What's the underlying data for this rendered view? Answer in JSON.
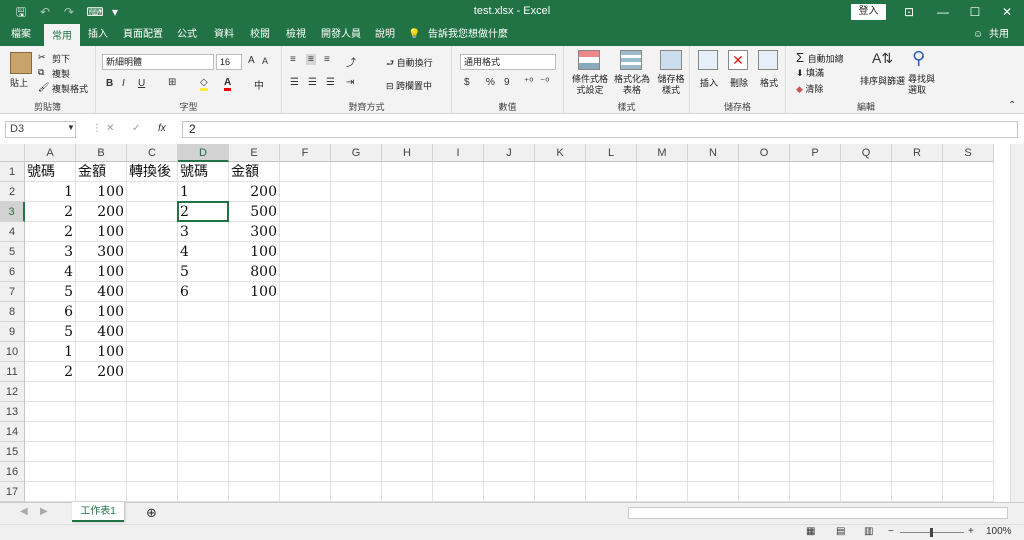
{
  "window": {
    "title": "test.xlsx  -  Excel",
    "login": "登入",
    "min": "—",
    "restore": "☐",
    "close": "✕",
    "ribbon_display": "⊡"
  },
  "quick_access": {
    "save": "🖫",
    "undo": "↶",
    "redo": "↷",
    "touch": "⌨",
    "customize": "▾"
  },
  "menu": {
    "items": [
      "檔案",
      "常用",
      "插入",
      "頁面配置",
      "公式",
      "資料",
      "校閱",
      "檢視",
      "開發人員",
      "說明"
    ],
    "active": "常用",
    "tell_me": "告訴我您想做什麼",
    "share": "共用"
  },
  "ribbon": {
    "clipboard": {
      "paste": "貼上",
      "cut": "剪下",
      "copy": "複製",
      "format_painter": "複製格式",
      "label": "剪貼簿"
    },
    "font": {
      "name": "新細明體",
      "size": "16",
      "grow": "A",
      "shrink": "A",
      "bold": "B",
      "italic": "I",
      "underline": "U",
      "label": "字型"
    },
    "alignment": {
      "wrap": "自動換行",
      "merge": "跨欄置中",
      "label": "對齊方式"
    },
    "number": {
      "format": "通用格式",
      "currency": "$",
      "percent": "%",
      "comma": "9",
      "label": "數值"
    },
    "styles": {
      "conditional": "條件式格式設定",
      "as_table": "格式化為表格",
      "cell_styles": "儲存格樣式",
      "label": "樣式"
    },
    "cells": {
      "insert": "插入",
      "delete": "刪除",
      "format": "格式",
      "label": "儲存格"
    },
    "editing": {
      "autosum": "自動加總",
      "fill": "填滿",
      "clear": "清除",
      "sort": "排序與篩選",
      "find": "尋找與選取",
      "label": "編輯"
    }
  },
  "formula_bar": {
    "cell_ref": "D3",
    "value": "2",
    "cancel": "✕",
    "enter": "✓",
    "fx": "fx"
  },
  "columns": [
    "A",
    "B",
    "C",
    "D",
    "E",
    "F",
    "G",
    "H",
    "I",
    "J",
    "K",
    "L",
    "M",
    "N",
    "O",
    "P",
    "Q",
    "R",
    "S"
  ],
  "rows": [
    "1",
    "2",
    "3",
    "4",
    "5",
    "6",
    "7",
    "8",
    "9",
    "10",
    "11",
    "12",
    "13",
    "14",
    "15",
    "16",
    "17"
  ],
  "cells": {
    "A": [
      "號碼",
      "1",
      "2",
      "2",
      "3",
      "4",
      "5",
      "6",
      "5",
      "1",
      "2"
    ],
    "B": [
      "金額",
      "100",
      "200",
      "100",
      "300",
      "100",
      "400",
      "100",
      "400",
      "100",
      "200"
    ],
    "C": [
      "轉換後"
    ],
    "D": [
      "號碼",
      "1",
      "2",
      "3",
      "4",
      "5",
      "6"
    ],
    "E": [
      "金額",
      "200",
      "500",
      "300",
      "100",
      "800",
      "100"
    ]
  },
  "selected_cell": "D3",
  "sheets": [
    "工作表1"
  ],
  "status": {
    "zoom": "100%",
    "zoom_minus": "−",
    "zoom_plus": "+"
  },
  "colors": {
    "accent": "#217346"
  }
}
